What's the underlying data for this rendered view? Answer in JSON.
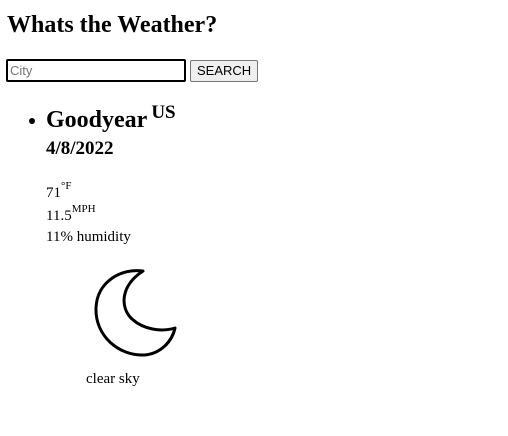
{
  "page": {
    "title": "Whats the Weather?"
  },
  "search": {
    "placeholder": "City",
    "value": "",
    "button_label": "SEARCH"
  },
  "results": [
    {
      "city": "Goodyear",
      "country": "US",
      "date": "4/8/2022",
      "temperature": "71",
      "temperature_unit": "°F",
      "wind": "11.5",
      "wind_unit": "MPH",
      "humidity": "11% humidity",
      "icon": "moon-icon",
      "description": "clear sky"
    }
  ]
}
